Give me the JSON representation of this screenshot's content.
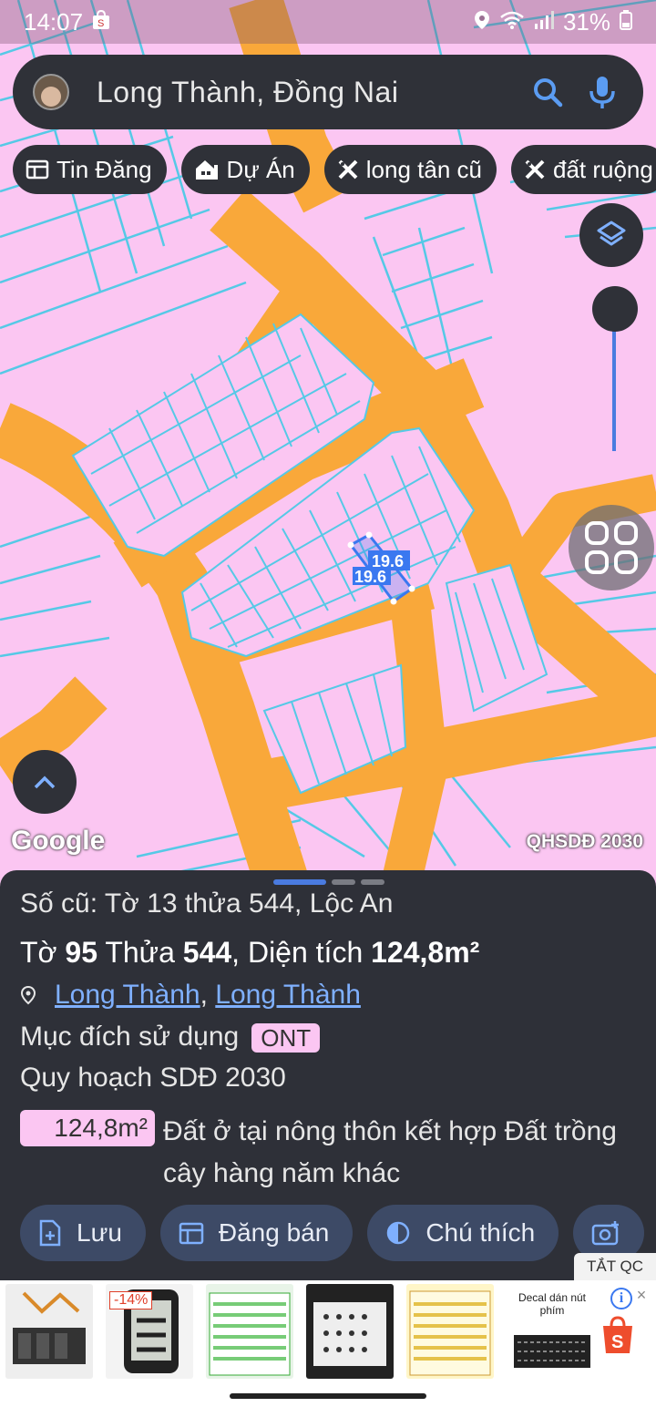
{
  "status_bar": {
    "time": "14:07",
    "battery": "31%"
  },
  "search": {
    "text": "Long Thành, Đồng Nai"
  },
  "chips": [
    {
      "label": "Tin Đăng",
      "icon": "newspaper-icon"
    },
    {
      "label": "Dự Án",
      "icon": "building-icon"
    },
    {
      "label": "long tân cũ",
      "icon": "tools-icon"
    },
    {
      "label": "đất ruộng",
      "icon": "tools-icon"
    }
  ],
  "map": {
    "parcel_labels": [
      "19.6",
      "19.6"
    ],
    "attribution": "Google",
    "layer_label": "QHSDĐ 2030",
    "colors": {
      "background": "#fbc6f2",
      "road": "#f9a83a",
      "parcel_line": "#55c9e6",
      "selected": "#3a78f0"
    }
  },
  "parcel": {
    "old_info": "Số cũ: Tờ 13 thửa 544, Lộc An",
    "to_label": "Tờ",
    "to_value": "95",
    "thua_label": "Thửa",
    "thua_value": "544",
    "area_label": ", Diện tích",
    "area_value": "124,8m²",
    "location_link_1": "Long Thành",
    "location_sep": ",",
    "location_link_2": "Long Thành",
    "purpose_label": "Mục đích sử dụng",
    "purpose_code": "ONT",
    "plan_label": "Quy hoạch SDĐ 2030",
    "plan_area": "124,8m²",
    "plan_description": "Đất ở tại nông thôn kết hợp Đất trồng cây hàng năm khác"
  },
  "actions": [
    {
      "label": "Lưu",
      "icon": "add-document-icon"
    },
    {
      "label": "Đăng bán",
      "icon": "calendar-icon"
    },
    {
      "label": "Chú thích",
      "icon": "contrast-icon"
    },
    {
      "label": "",
      "icon": "add-photo-icon"
    }
  ],
  "ad": {
    "hide_label": "TẮT QC",
    "discount": "-14%",
    "decal_title": "Decal dán nút phím"
  }
}
